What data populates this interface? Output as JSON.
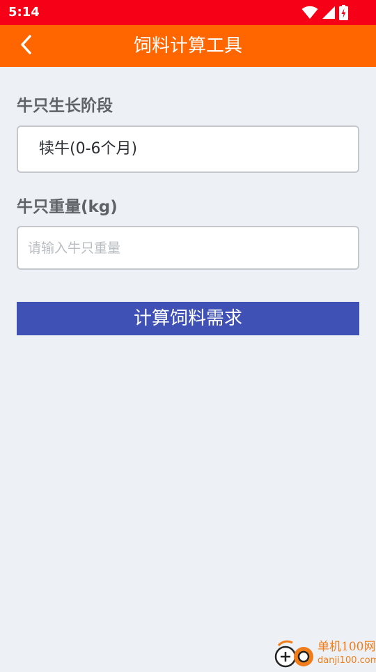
{
  "status_bar": {
    "time": "5:14",
    "icons": [
      "wifi-icon",
      "cellular-signal-icon",
      "battery-charging-icon"
    ]
  },
  "app_bar": {
    "title": "饲料计算工具",
    "back_icon": "chevron-left-icon"
  },
  "form": {
    "stage_label": "牛只生长阶段",
    "stage_selected": "犊牛(0-6个月)",
    "weight_label": "牛只重量(kg)",
    "weight_value": "",
    "weight_placeholder": "请输入牛只重量",
    "submit_label": "计算饲料需求"
  },
  "watermark": {
    "name": "单机100网",
    "domain": "danji100.com"
  },
  "colors": {
    "status_bar": "#f50016",
    "app_bar": "#ff6600",
    "page_background": "#edf1f5",
    "button": "#3f51b5",
    "watermark": "#f07d1a"
  }
}
